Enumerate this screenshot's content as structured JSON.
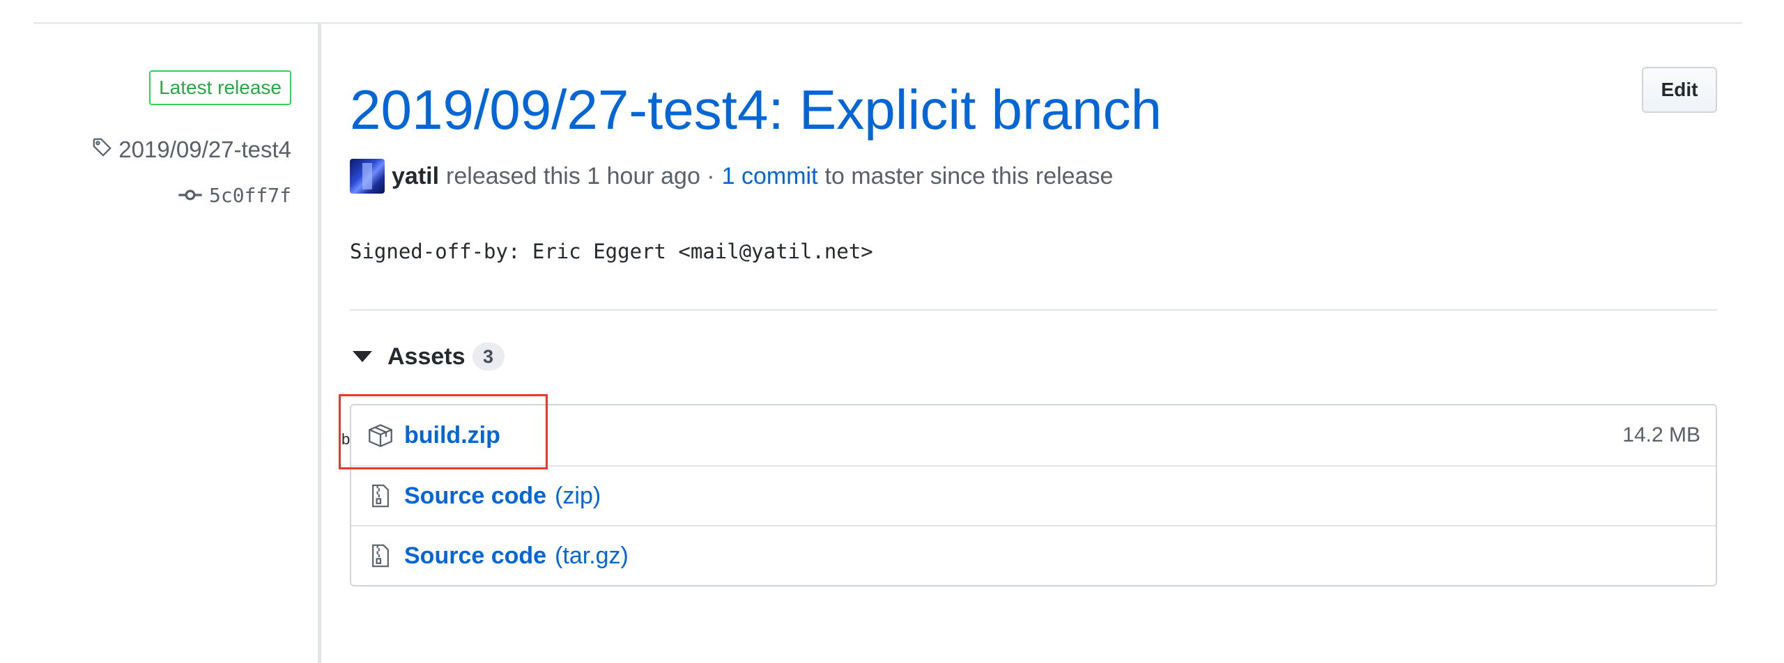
{
  "sidebar": {
    "badge": "Latest release",
    "tag": "2019/09/27-test4",
    "commit": "5c0ff7f",
    "tag_icon": "tag-icon",
    "commit_icon": "git-commit-icon"
  },
  "release": {
    "title": "2019/09/27-test4: Explicit branch",
    "edit_label": "Edit",
    "author": "yatil",
    "released_text": "released this 1 hour ago ·",
    "commit_link": "1 commit",
    "since_text": "to master since this release",
    "body": "Signed-off-by: Eric Eggert <mail@yatil.net>"
  },
  "assets": {
    "label": "Assets",
    "count": "3",
    "items": [
      {
        "name": "build.zip",
        "ext": "",
        "size": "14.2 MB",
        "icon": "package-icon"
      },
      {
        "name": "Source code",
        "ext": "(zip)",
        "size": "",
        "icon": "file-zip-icon"
      },
      {
        "name": "Source code",
        "ext": "(tar.gz)",
        "size": "",
        "icon": "file-zip-icon"
      }
    ]
  },
  "overlay": {
    "stray_glyph": "b"
  },
  "colors": {
    "link": "#0366d6",
    "badge_green": "#28a745",
    "highlight_red": "#e8392a"
  }
}
